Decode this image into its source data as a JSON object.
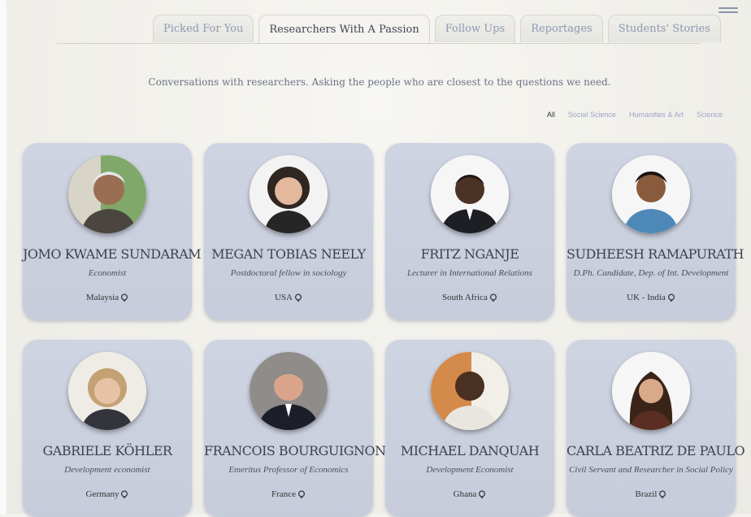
{
  "tabs": [
    {
      "label": "Picked For You",
      "active": false
    },
    {
      "label": "Researchers With A Passion",
      "active": true
    },
    {
      "label": "Follow Ups",
      "active": false
    },
    {
      "label": "Reportages",
      "active": false
    },
    {
      "label": "Students' Stories",
      "active": false
    }
  ],
  "subtitle": "Conversations with researchers. Asking the people who are closest to the questions we need.",
  "filters": [
    {
      "label": "All",
      "active": true
    },
    {
      "label": "Social Science",
      "active": false
    },
    {
      "label": "Humanities & Art",
      "active": false
    },
    {
      "label": "Science",
      "active": false
    }
  ],
  "researchers": [
    {
      "name": "JOMO KWAME SUNDARAM",
      "role": "Economist",
      "location": "Malaysia"
    },
    {
      "name": "MEGAN TOBIAS NEELY",
      "role": "Postdoctoral fellow in sociology",
      "location": "USA"
    },
    {
      "name": "FRITZ NGANJE",
      "role": "Lecturer in International Relations",
      "location": "South Africa"
    },
    {
      "name": "SUDHEESH RAMAPURATH",
      "role": "D.Ph. Candidate, Dep. of Int. Development",
      "location": "UK - India"
    },
    {
      "name": "GABRIELE KÖHLER",
      "role": "Development economist",
      "location": "Germany"
    },
    {
      "name": "FRANCOIS BOURGUIGNON",
      "role": "Emeritus Professor of Economics",
      "location": "France"
    },
    {
      "name": "MICHAEL DANQUAH",
      "role": "Development Economist",
      "location": "Ghana"
    },
    {
      "name": "CARLA BEATRIZ DE PAULO",
      "role": "Civil Servant and Researcher in Social Policy",
      "location": "Brazil"
    }
  ],
  "icons": {
    "menu": "hamburger-menu-icon",
    "location": "location-pin-icon"
  }
}
